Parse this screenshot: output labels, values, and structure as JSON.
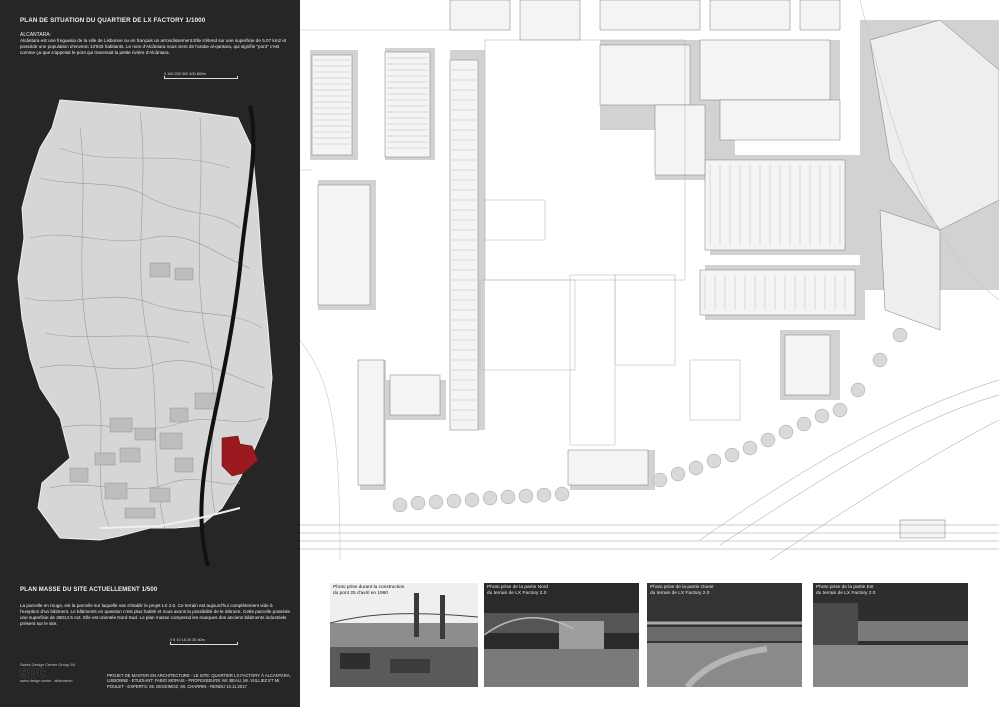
{
  "left_panel": {
    "title": "PLAN DE SITUATION DU QUARTIER DE LX FACTORY  1/1000",
    "intro_heading": "ALCANTARA:",
    "intro_text": "Alcântara est une freguesia de la ville de Lisbonne ou en français un arrondissement.Elle s'étend sur une superficie de 5.07 km2 et possède une population d'environ 13'943 habitants. Le nom d'Alcântara nous vient de l'arabe al-qantara, qui signifie \"pont\"  c'est comme ça que s'appelait le pont qui traversait la petite rivière d'Alcântara.",
    "scale1_ticks": "0   100 200 300 400      800m",
    "plan_title": "PLAN MASSE DU SITE ACTUELLEMENT 1/500",
    "plan_text": "La parcelle en rouge, est la parcelle sur laquelle vas s'établir le projet LX 2.0. Ce terrain est aujourd'hui complètement vide à l'exeption d'un bâtiment. Le bâtiments en question n'est plus habité et nous avons la possibilité de le détruire. Cette parcelle possède une superficie de 36014.5 m2. Elle est orientée Nord-Sud. Le plan masse comprend les marques des anciens bâtiments industriels présent sur le site.",
    "scale2_ticks": "0   5  10 15 20      30       40m",
    "logo_line1": "Swiss Design Center Group 54",
    "logo_mark": "SDC",
    "logo_line2": "swiss design center - athenaeum",
    "credits": "PROJET DE MASTER EN ARCHITECTURE  -  LE SITE: QUARTIER LX FACTORY À ALCANTARA, LISBONNE - ETUDIANT: FABIO MORAIS - PROFESSEURS: Mr. BEAU, Mr. VULLIEZ ET Mr. POULET - EXPERTS: Mr. DESSIMOZ, Mr. CHARRIN - RENDU 13.11.2017"
  },
  "colors": {
    "panel_bg": "#262626",
    "site_red": "#9b1a1f",
    "map_land": "#d6d6d6"
  },
  "photos": [
    {
      "caption_line1": "Photo prise durant la construction",
      "caption_line2": "du pont 25 d'avril en 1960"
    },
    {
      "caption_line1": "Photo prise de la partie Nord",
      "caption_line2": "du terrain de LX Factory 2.0"
    },
    {
      "caption_line1": "Photo prise de la partie Ouest",
      "caption_line2": "du terrain de LX Factory 2.0"
    },
    {
      "caption_line1": "Photo prise de la partie Est",
      "caption_line2": "du terrain de LX Factory 2.0"
    }
  ]
}
